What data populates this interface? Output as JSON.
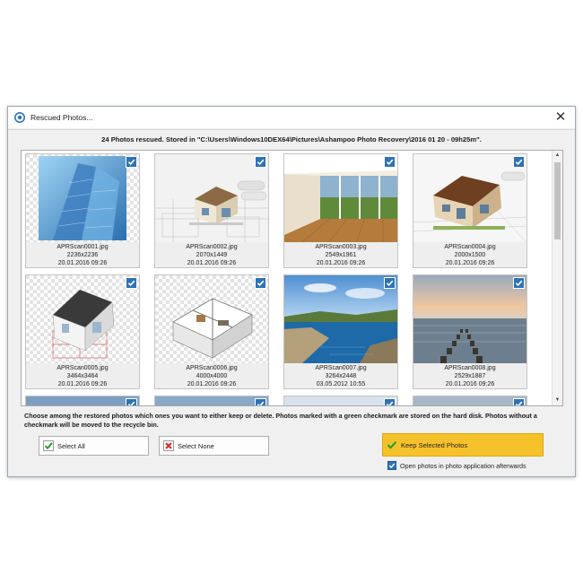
{
  "window": {
    "title": "Rescued Photos...",
    "close_glyph": "✕"
  },
  "headline": "24 Photos rescued. Stored in \"C:\\Users\\Windows10DEX64\\Pictures\\Ashampoo Photo Recovery\\2016 01 20 - 09h25m\".",
  "photos": [
    {
      "name": "APRScan0001.jpg",
      "dims": "2236x2236",
      "date": "20.01.2016 09:26",
      "checked": true
    },
    {
      "name": "APRScan0002.jpg",
      "dims": "2070x1449",
      "date": "20.01.2016 09:26",
      "checked": true
    },
    {
      "name": "APRScan0003.jpg",
      "dims": "2549x1961",
      "date": "20.01.2016 09:26",
      "checked": true
    },
    {
      "name": "APRScan0004.jpg",
      "dims": "2000x1500",
      "date": "20.01.2016 09:26",
      "checked": true
    },
    {
      "name": "APRScan0005.jpg",
      "dims": "3464x3464",
      "date": "20.01.2016 09:26",
      "checked": true
    },
    {
      "name": "APRScan0006.jpg",
      "dims": "4000x4000",
      "date": "20.01.2016 09:26",
      "checked": true
    },
    {
      "name": "APRScan0007.jpg",
      "dims": "3264x2448",
      "date": "03.05.2012 10:55",
      "checked": true
    },
    {
      "name": "APRScan0008.jpg",
      "dims": "2529x1887",
      "date": "20.01.2016 09:26",
      "checked": true
    }
  ],
  "info_text": "Choose among the restored photos which ones you want to either keep or delete. Photos marked with a green checkmark are stored on the hard disk. Photos without a checkmark will be moved to the recycle bin.",
  "buttons": {
    "select_all": "Select All",
    "select_none": "Select None",
    "keep_selected": "Keep Selected Photos"
  },
  "open_after": {
    "label": "Open photos in photo application afterwards",
    "checked": true
  },
  "colors": {
    "checkbox_blue": "#2f73b4",
    "keep_button": "#f6c22c",
    "check_green": "#2e9e2e",
    "x_red": "#d12a2a"
  }
}
